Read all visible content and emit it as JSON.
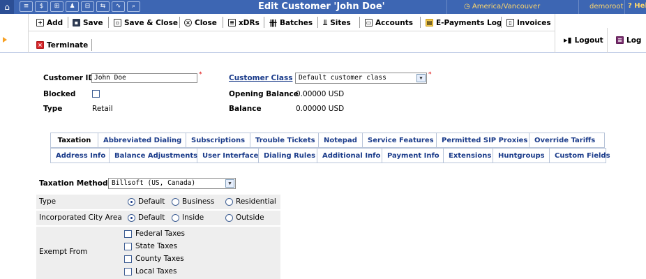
{
  "topbar": {
    "title": "Edit Customer 'John Doe'",
    "timezone": "America/Vancouver",
    "user": "demoroot",
    "help": "Help",
    "nav_icons": [
      "home-icon",
      "list-icon",
      "dollar-icon",
      "grid-icon",
      "person-icon",
      "doc-icon",
      "transfer-icon",
      "chart-icon",
      "search-icon"
    ]
  },
  "toolbar": {
    "add": "Add",
    "save": "Save",
    "save_close": "Save & Close",
    "close": "Close",
    "xdrs": "xDRs",
    "batches": "Batches",
    "sites": "Sites",
    "accounts": "Accounts",
    "epayments": "E-Payments Log",
    "invoices": "Invoices",
    "terminate": "Terminate",
    "logout": "Logout",
    "log": "Log"
  },
  "form": {
    "customer_id_label": "Customer ID",
    "customer_id_value": "John Doe",
    "blocked_label": "Blocked",
    "type_label": "Type",
    "type_value": "Retail",
    "customer_class_label": "Customer Class",
    "customer_class_value": "Default customer class",
    "opening_balance_label": "Opening Balance",
    "opening_balance_value": "0.00000 USD",
    "balance_label": "Balance",
    "balance_value": "0.00000 USD"
  },
  "tabs": {
    "row1": [
      "Taxation",
      "Abbreviated Dialing",
      "Subscriptions",
      "Trouble Tickets",
      "Notepad",
      "Service Features",
      "Permitted SIP Proxies",
      "Override Tariffs"
    ],
    "row2": [
      "Address Info",
      "Balance Adjustments",
      "User Interface",
      "Dialing Rules",
      "Additional Info",
      "Payment Info",
      "Extensions",
      "Huntgroups",
      "Custom Fields"
    ],
    "active": "Taxation"
  },
  "taxation": {
    "method_label": "Taxation Method",
    "method_value": "Billsoft (US, Canada)",
    "type_label": "Type",
    "type_options": [
      "Default",
      "Business",
      "Residential"
    ],
    "type_selected": "Default",
    "city_label": "Incorporated City Area",
    "city_options": [
      "Default",
      "Inside",
      "Outside"
    ],
    "city_selected": "Default",
    "exempt_label": "Exempt From",
    "exempt_options": [
      "Federal Taxes",
      "State Taxes",
      "County Taxes",
      "Local Taxes"
    ]
  }
}
